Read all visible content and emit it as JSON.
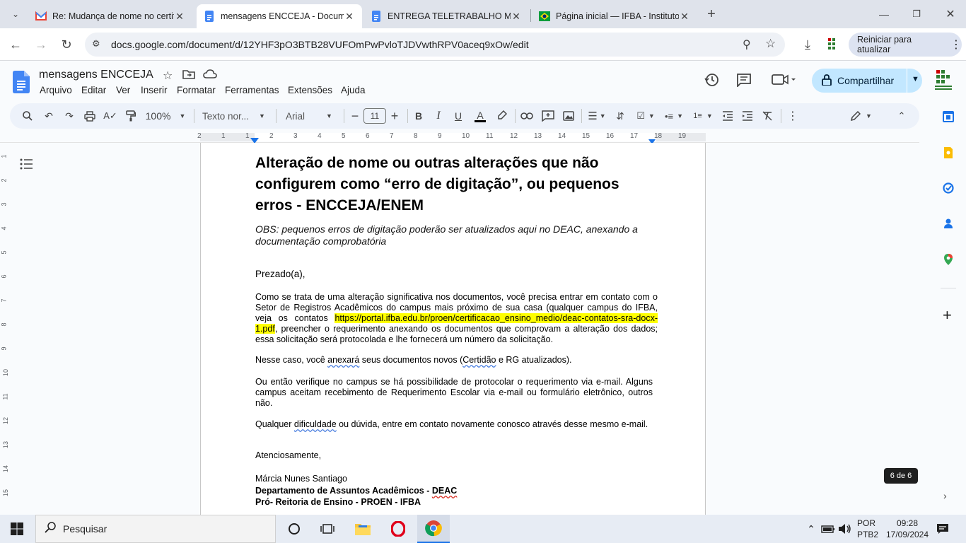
{
  "browser": {
    "tabs": [
      {
        "title": "Re: Mudança de nome no certif",
        "favicon": "gmail-icon"
      },
      {
        "title": "mensagens ENCCEJA - Docume",
        "favicon": "docs-icon",
        "active": true
      },
      {
        "title": "ENTREGA TELETRABALHO MAR",
        "favicon": "docs-icon"
      },
      {
        "title": "Página inicial — IFBA - Instituto",
        "favicon": "ifba-icon"
      }
    ],
    "url": "docs.google.com/document/d/12YHF3pO3BTB28VUFOmPwPvloTJDVwthRPV0aceq9xOw/edit",
    "update_label": "Reiniciar para atualizar"
  },
  "docs": {
    "title": "mensagens ENCCEJA",
    "menus": [
      "Arquivo",
      "Editar",
      "Ver",
      "Inserir",
      "Formatar",
      "Ferramentas",
      "Extensões",
      "Ajuda"
    ],
    "share_label": "Compartilhar",
    "toolbar": {
      "zoom": "100%",
      "style": "Texto nor...",
      "font": "Arial",
      "size": "11"
    },
    "ruler_numbers": [
      "2",
      "1",
      "1",
      "2",
      "3",
      "4",
      "5",
      "6",
      "7",
      "8",
      "9",
      "10",
      "11",
      "12",
      "13",
      "14",
      "15",
      "16",
      "17",
      "18",
      "19"
    ],
    "vruler_numbers": [
      "1",
      "2",
      "3",
      "4",
      "5",
      "6",
      "7",
      "8",
      "9",
      "10",
      "11",
      "12",
      "13",
      "14",
      "15"
    ],
    "page_badge": "6 de 6"
  },
  "document": {
    "heading": "Alteração de nome ou outras alterações que não configurem como “erro de digitação”, ou pequenos erros - ENCCEJA/ENEM",
    "obs": "OBS: pequenos erros de digitação poderão ser atualizados aqui no DEAC, anexando a documentação comprobatória",
    "greeting": "Prezado(a),",
    "p1_start": "Como se trata de uma alteração significativa nos documentos, você precisa entrar em contato com o Setor de Registros Acadêmicos do campus mais próximo de sua casa (qualquer campus do IFBA, veja os contatos ",
    "p1_link": "https://portal.ifba.edu.br/proen/certificacao_ensino_medio/deac-contatos-sra-docx-1.pdf",
    "p1_end": ", preencher o requerimento anexando os documentos que comprovam a alteração dos dados; essa solicitação será protocolada e lhe fornecerá um número da solicitação.",
    "p2_a": "Nesse caso, você ",
    "p2_b": "anexará",
    "p2_c": " seus documentos novos (",
    "p2_d": "Certidão",
    "p2_e": " e RG atualizados).",
    "p3": "Ou então verifique no campus se há possibilidade de protocolar o requerimento via e-mail. Alguns campus aceitam recebimento de Requerimento Escolar via e-mail ou formulário eletrônico, outros não.",
    "p4_a": "Qualquer ",
    "p4_b": "dificuldade",
    "p4_c": " ou dúvida, entre em contato novamente conosco através desse mesmo e-mail.",
    "closing": "Atenciosamente,",
    "sig_name": "Márcia Nunes Santiago",
    "sig_dept_a": "Departamento de Assuntos Acadêmicos - ",
    "sig_dept_b": "DEAC",
    "sig_unit": "Pró- Reitoria de Ensino - PROEN - IFBA"
  },
  "taskbar": {
    "search_placeholder": "Pesquisar",
    "lang_top": "POR",
    "lang_bottom": "PTB2",
    "time": "09:28",
    "date": "17/09/2024"
  }
}
